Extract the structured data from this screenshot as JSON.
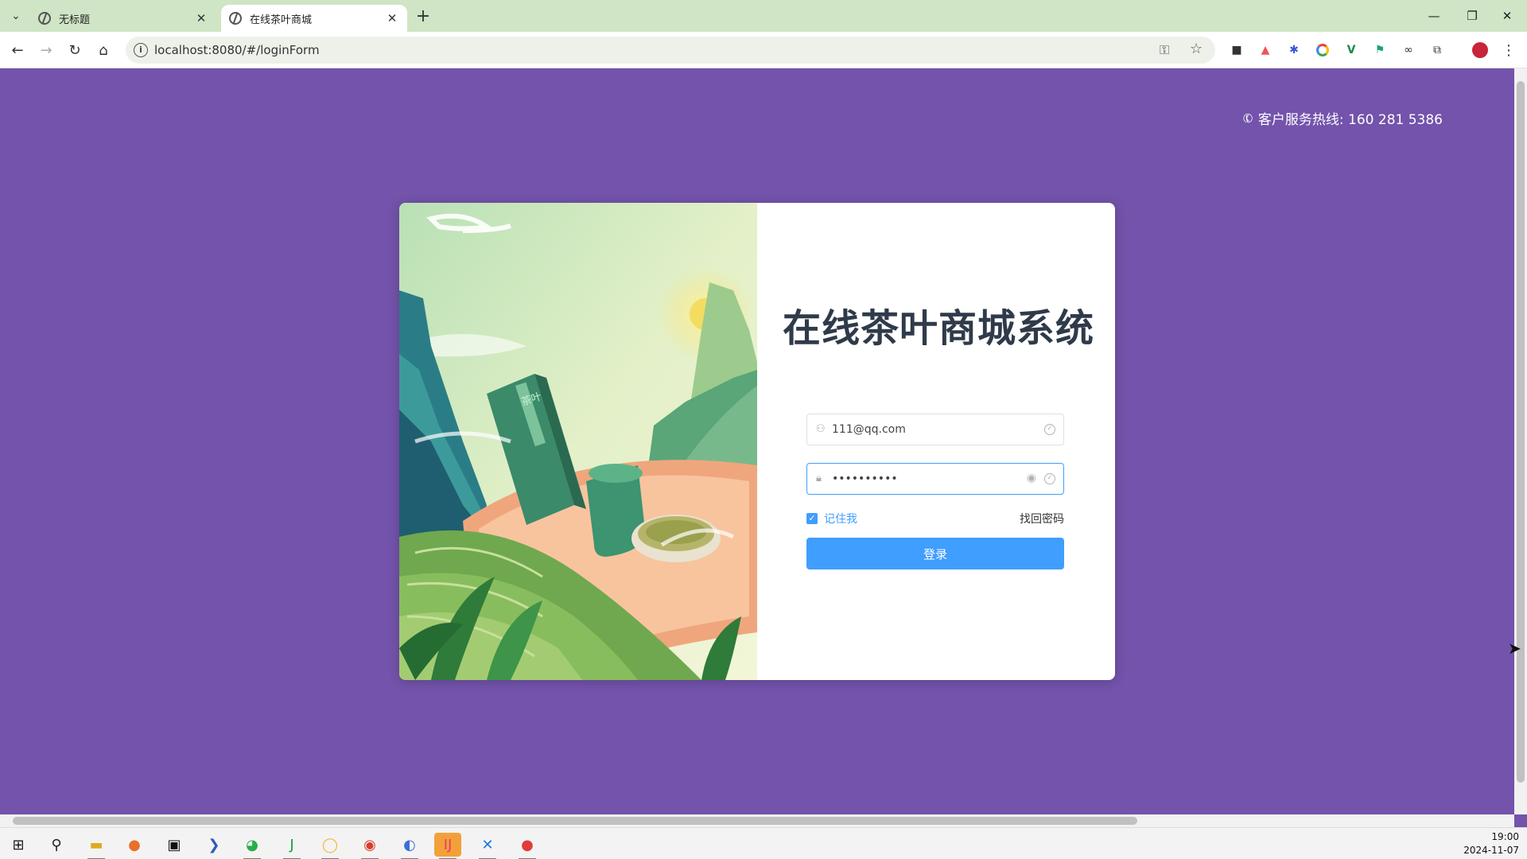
{
  "browser": {
    "tabs": [
      {
        "title": "无标题",
        "close": "✕"
      },
      {
        "title": "在线茶叶商城",
        "close": "✕"
      }
    ],
    "new_tab": "+",
    "url": "localhost:8080/#/loginForm"
  },
  "page": {
    "hotline": "客户服务热线: 160 281 5386",
    "title": "在线茶叶商城系统",
    "illustration_text": "茶叶",
    "username": "111@qq.com",
    "password_masked": "••••••••••",
    "remember_label": "记住我",
    "remember_checked": true,
    "forgot_label": "找回密码",
    "login_label": "登录",
    "accent_color": "#409eff",
    "background_color": "#7353ab"
  },
  "taskbar": {
    "time": "19:00",
    "date": "2024-11-07"
  }
}
